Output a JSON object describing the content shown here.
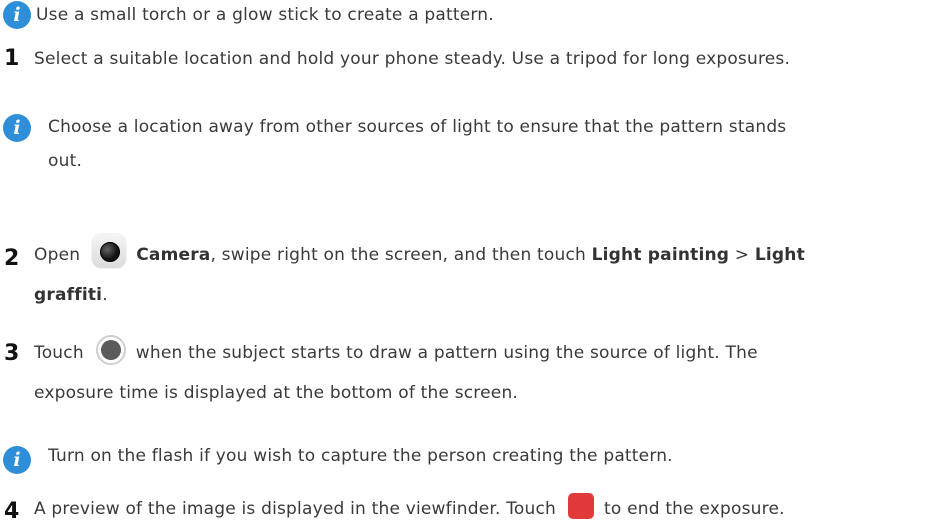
{
  "note1": {
    "text": "Use a small torch or a glow stick to create a pattern."
  },
  "step1": {
    "num": "1",
    "text": "Select a suitable location and hold your phone steady. Use a tripod for long exposures."
  },
  "note2": {
    "line1": "Choose a location away from other sources of light to ensure that the pattern stands",
    "line2": "out."
  },
  "step2": {
    "num": "2",
    "open": "Open",
    "camera": "Camera",
    "mid": ", swipe right on the screen, and then touch",
    "light_painting": "Light painting",
    "sep": ">",
    "light": "Light",
    "graffiti": "graffiti",
    "end": "."
  },
  "step3": {
    "num": "3",
    "touch": "Touch",
    "rest1": "when the subject starts to draw a pattern using the source of light. The",
    "line2": "exposure time is displayed at the bottom of the screen."
  },
  "note3": {
    "text": "Turn on the flash if you wish to capture the person creating the pattern."
  },
  "step4": {
    "num": "4",
    "before": "A preview of the image is displayed in the viewfinder. Touch",
    "after": "to end the exposure."
  },
  "icons": {
    "note": "info-icon",
    "camera": "camera-app-icon",
    "shutter": "shutter-button-icon",
    "stop": "stop-button-icon"
  },
  "colors": {
    "info_icon": "#2e8fd8",
    "stop_icon": "#e23a3a"
  }
}
